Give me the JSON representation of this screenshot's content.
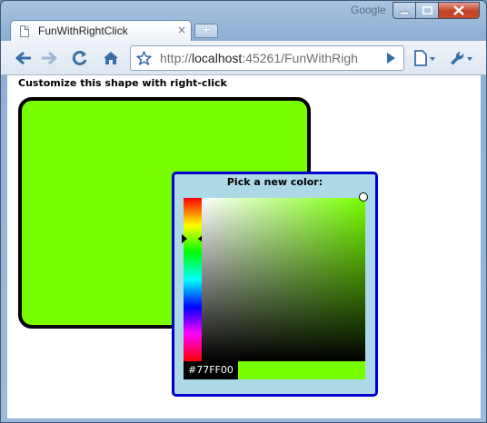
{
  "window": {
    "brand": "Google",
    "controls": {
      "minimize": "–",
      "maximize": "□",
      "close": "✕"
    }
  },
  "tab": {
    "title": "FunWithRightClick",
    "close": "×",
    "new_tab": "+"
  },
  "toolbar": {
    "back_icon": "back-arrow-icon",
    "forward_icon": "forward-arrow-icon",
    "reload_icon": "reload-icon",
    "home_icon": "home-icon",
    "bookmark_icon": "star-icon",
    "go_icon": "play-arrow-icon",
    "page_menu_icon": "page-icon",
    "tools_menu_icon": "wrench-icon"
  },
  "address": {
    "scheme": "http://",
    "host": "localhost",
    "rest": ":45261/FunWithRigh"
  },
  "page": {
    "heading": "Customize this shape with right-click",
    "shape_color": "#77FF00"
  },
  "picker": {
    "title": "Pick a new color:",
    "hex_value": "#77FF00",
    "selected_color": "#77ff00",
    "border_color": "#0000cc",
    "background_color": "#add8e6"
  }
}
